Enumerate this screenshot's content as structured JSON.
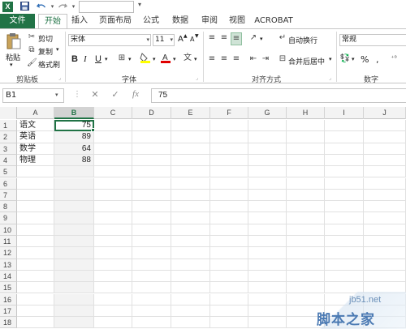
{
  "title_bar": {
    "app_logo": "X",
    "save_icon": "save-icon",
    "undo_icon": "undo-icon",
    "redo_icon": "redo-icon"
  },
  "tabs": [
    {
      "label": "文件"
    },
    {
      "label": "开始"
    },
    {
      "label": "插入"
    },
    {
      "label": "页面布局"
    },
    {
      "label": "公式"
    },
    {
      "label": "数据"
    },
    {
      "label": "审阅"
    },
    {
      "label": "视图"
    },
    {
      "label": "ACROBAT"
    }
  ],
  "ribbon": {
    "clipboard": {
      "paste_label": "粘贴",
      "cut_label": "剪切",
      "copy_label": "复制",
      "format_painter_label": "格式刷",
      "group_label": "剪贴板"
    },
    "font": {
      "font_name": "宋体",
      "font_size": "11",
      "bold": "B",
      "italic": "I",
      "underline": "U",
      "grow": "A",
      "shrink": "A",
      "group_label": "字体"
    },
    "alignment": {
      "wrap_text_label": "自动换行",
      "merge_center_label": "合并后居中",
      "group_label": "对齐方式"
    },
    "number": {
      "format": "常规",
      "percent": "%",
      "group_label": "数字"
    }
  },
  "formula_bar": {
    "name_box": "B1",
    "fx_label": "fx",
    "formula": "75"
  },
  "sheet": {
    "columns": [
      "A",
      "B",
      "C",
      "D",
      "E",
      "F",
      "G",
      "H",
      "I",
      "J"
    ],
    "rows": [
      "1",
      "2",
      "3",
      "4",
      "5",
      "6",
      "7",
      "8",
      "9",
      "10",
      "11",
      "12",
      "13",
      "14",
      "15",
      "16",
      "17",
      "18"
    ],
    "data": [
      {
        "a": "语文",
        "b": "75"
      },
      {
        "a": "英语",
        "b": "89"
      },
      {
        "a": "数学",
        "b": "64"
      },
      {
        "a": "物理",
        "b": "88"
      }
    ],
    "selected_cell": "B1"
  },
  "watermark": {
    "url": "jb51.net",
    "name": "脚本之家"
  },
  "colors": {
    "accent": "#217346",
    "header_bg": "#f3f3f3",
    "grid_line": "#e1e1e1"
  }
}
